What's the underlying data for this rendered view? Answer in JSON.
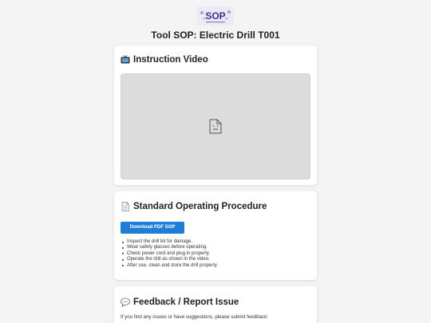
{
  "logo": {
    "text": "SOP"
  },
  "page_title": "Tool SOP: Electric Drill T001",
  "video_section": {
    "icon": "tv-icon",
    "heading": "Instruction Video",
    "placeholder_icon": "broken-document-icon"
  },
  "sop_section": {
    "icon": "document-icon",
    "heading": "Standard Operating Procedure",
    "download_label": "Download PDF SOP",
    "steps": [
      "Inspect the drill bit for damage.",
      "Wear safety glasses before operating.",
      "Check power cord and plug in properly.",
      "Operate the drill as shown in the video.",
      "After use, clean and store the drill properly."
    ]
  },
  "feedback_section": {
    "icon": "speech-bubble-icon",
    "heading": "Feedback / Report Issue",
    "intro": "If you find any issues or have suggestions, please submit feedback:"
  },
  "colors": {
    "accent": "#1c7ed6",
    "background": "#f4f4f4",
    "card": "#ffffff",
    "video_placeholder": "#dcdcdc"
  }
}
